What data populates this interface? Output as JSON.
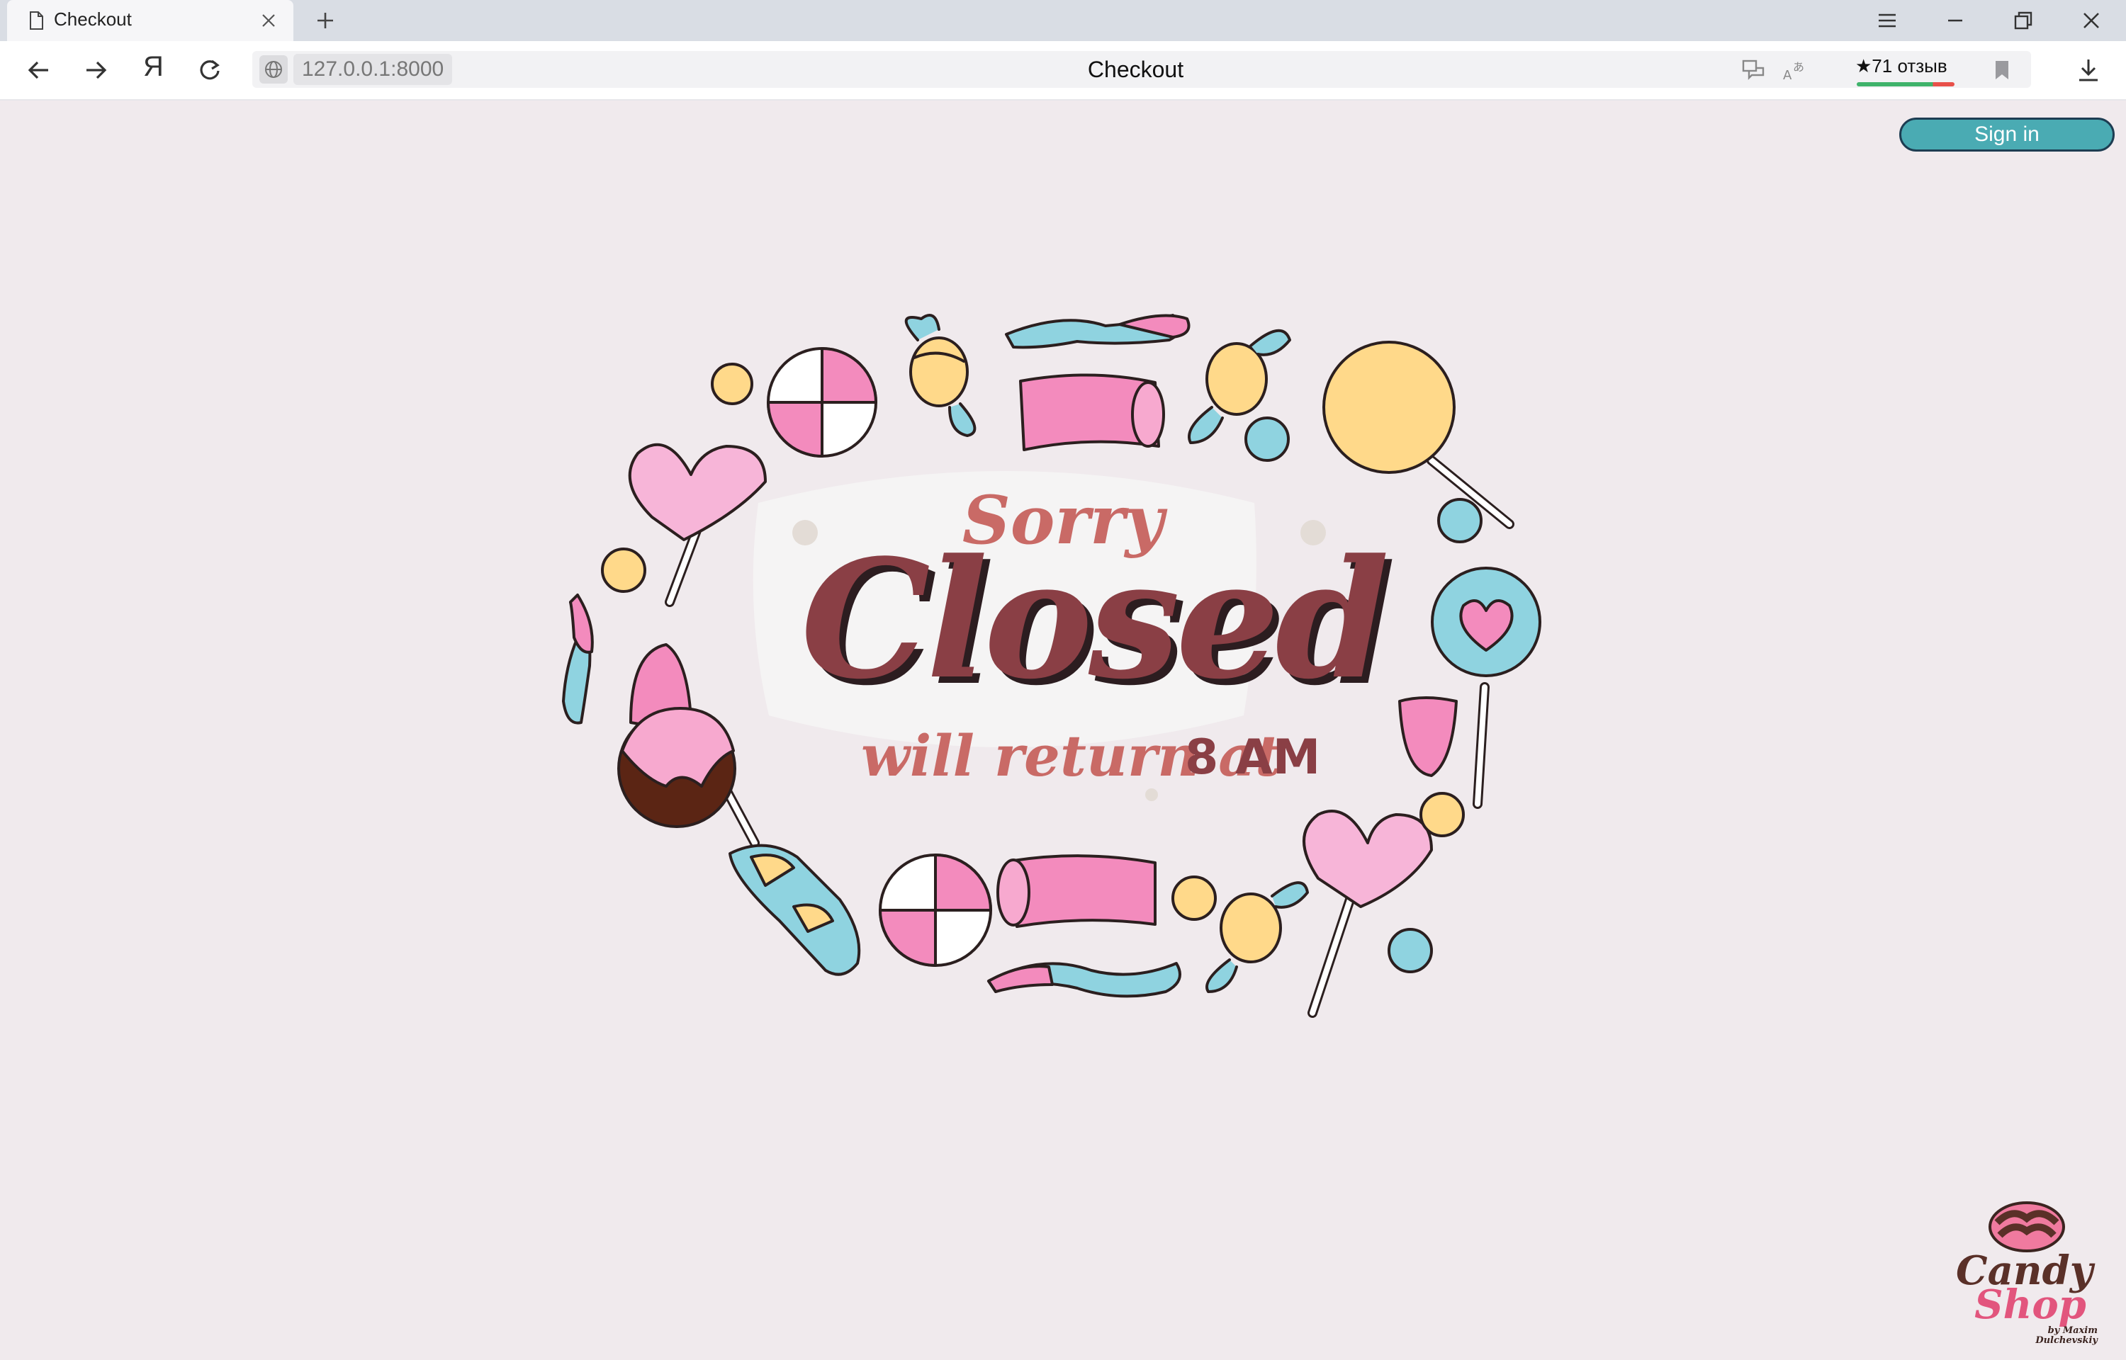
{
  "browser": {
    "tab_title": "Checkout",
    "yandex_label": "Я",
    "url": "127.0.0.1:8000",
    "page_heading": "Checkout",
    "rating_label": "★71 отзыв"
  },
  "header": {
    "sign_in_label": "Sign in"
  },
  "closed_sign": {
    "sorry": "Sorry",
    "closed": "Closed",
    "will_return": "will return at",
    "time": "8 AM"
  },
  "logo": {
    "line1": "Candy",
    "line2": "Shop",
    "byline": "by Maxim Dulchevskiy"
  },
  "colors": {
    "page_background": "#f0eaed",
    "sign_in_button": "#4aabb3",
    "closed_text": "#8a3f45",
    "accent_text": "#c96a66"
  }
}
